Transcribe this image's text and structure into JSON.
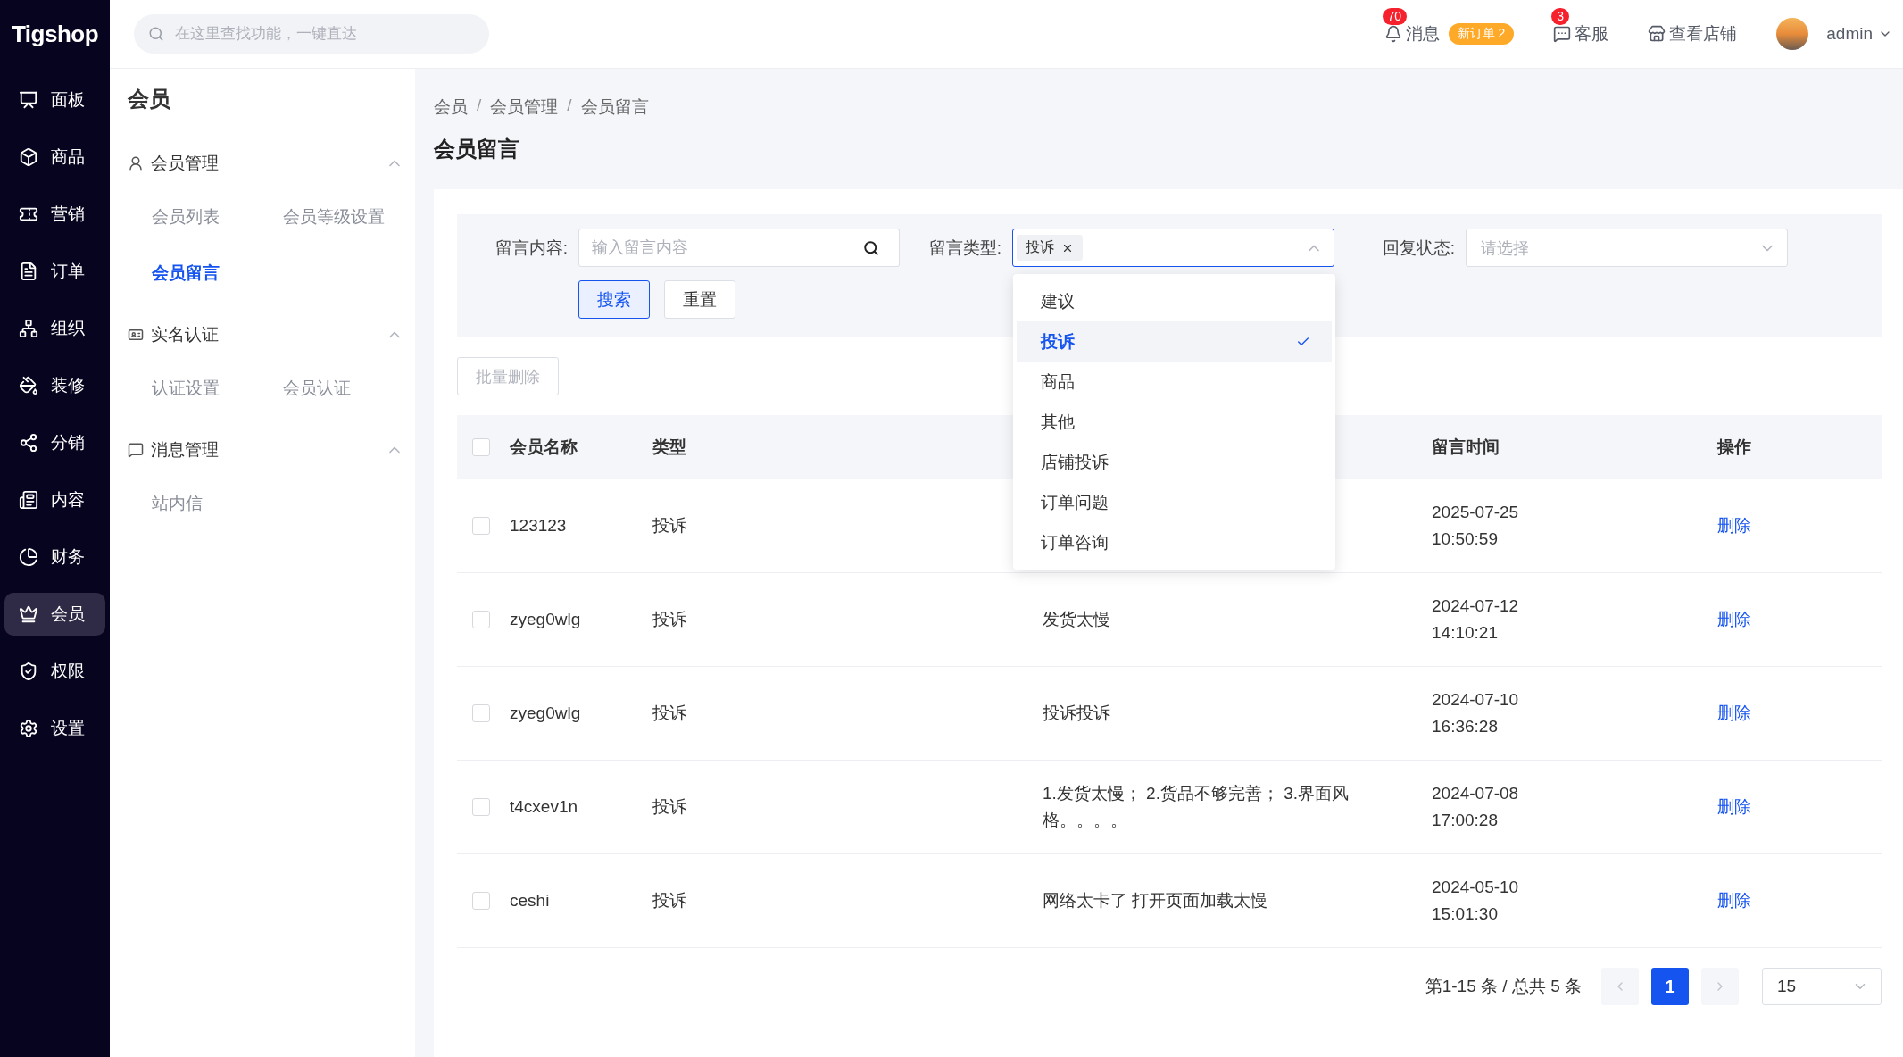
{
  "top_bar": {
    "logo": "Tigshop",
    "search": {
      "placeholder": "在这里查找功能，一键直达"
    },
    "messages": {
      "label": "消息",
      "badge": "70",
      "tag": "新订单 2"
    },
    "service": {
      "label": "客服",
      "badge": "3"
    },
    "store_link": "查看店铺",
    "user": "admin"
  },
  "nav": [
    {
      "label": "面板",
      "selected": false
    },
    {
      "label": "商品",
      "selected": false
    },
    {
      "label": "营销",
      "selected": false
    },
    {
      "label": "订单",
      "selected": false
    },
    {
      "label": "组织",
      "selected": false
    },
    {
      "label": "装修",
      "selected": false
    },
    {
      "label": "分销",
      "selected": false
    },
    {
      "label": "内容",
      "selected": false
    },
    {
      "label": "财务",
      "selected": false
    },
    {
      "label": "会员",
      "selected": true
    },
    {
      "label": "权限",
      "selected": false
    },
    {
      "label": "设置",
      "selected": false
    }
  ],
  "submenu": {
    "title": "会员",
    "groups": [
      {
        "title": "会员管理",
        "expanded": true,
        "items": [
          {
            "label": "会员列表",
            "selected": false
          },
          {
            "label": "会员等级设置",
            "selected": false
          },
          {
            "label": "会员留言",
            "selected": true
          }
        ]
      },
      {
        "title": "实名认证",
        "expanded": true,
        "items": [
          {
            "label": "认证设置",
            "selected": false
          },
          {
            "label": "会员认证",
            "selected": false
          }
        ]
      },
      {
        "title": "消息管理",
        "expanded": true,
        "items": [
          {
            "label": "站内信",
            "selected": false
          }
        ]
      }
    ]
  },
  "breadcrumb": {
    "items": [
      "会员",
      "会员管理",
      "会员留言"
    ],
    "separators": [
      "/",
      "/"
    ]
  },
  "page_title": "会员留言",
  "filters": [
    {
      "kind": "text",
      "label": "留言内容:",
      "placeholder": "输入留言内容"
    },
    {
      "kind": "multiselect",
      "label": "留言类型:",
      "tags": [
        "投诉"
      ],
      "open": true
    },
    {
      "kind": "select",
      "label": "回复状态:",
      "placeholder": "请选择"
    }
  ],
  "search_button": "搜索",
  "reset_button": "重置",
  "batch_delete": {
    "label": "批量删除",
    "disabled": true
  },
  "type_options": [
    {
      "label": "建议",
      "selected": false
    },
    {
      "label": "投诉",
      "selected": true
    },
    {
      "label": "商品",
      "selected": false
    },
    {
      "label": "其他",
      "selected": false
    },
    {
      "label": "店铺投诉",
      "selected": false
    },
    {
      "label": "订单问题",
      "selected": false
    },
    {
      "label": "订单咨询",
      "selected": false
    }
  ],
  "table": {
    "header": {
      "checked": false,
      "name": "会员名称",
      "type": "类型",
      "time": "留言时间",
      "action": "操作"
    },
    "rows": [
      {
        "checked": false,
        "name": "123123",
        "type": "投诉",
        "date": "2025-07-25",
        "clock": "10:50:59",
        "action": "删除"
      },
      {
        "checked": false,
        "name": "zyeg0wlg",
        "type": "投诉",
        "content": "发货太慢",
        "date": "2024-07-12",
        "clock": "14:10:21",
        "action": "删除"
      },
      {
        "checked": false,
        "name": "zyeg0wlg",
        "type": "投诉",
        "content": "投诉投诉",
        "date": "2024-07-10",
        "clock": "16:36:28",
        "action": "删除"
      },
      {
        "checked": false,
        "name": "t4cxev1n",
        "type": "投诉",
        "content": "1.发货太慢； 2.货品不够完善； 3.界面风格。。。。",
        "date": "2024-07-08",
        "clock": "17:00:28",
        "action": "删除"
      },
      {
        "checked": false,
        "name": "ceshi",
        "type": "投诉",
        "content": "网络太卡了 打开页面加载太慢",
        "date": "2024-05-10",
        "clock": "15:01:30",
        "action": "删除"
      }
    ]
  },
  "pagination": {
    "summary": "第1-15 条 / 总共 5 条",
    "pages": [
      {
        "label": "1",
        "selected": true
      }
    ],
    "page_size": "15"
  }
}
